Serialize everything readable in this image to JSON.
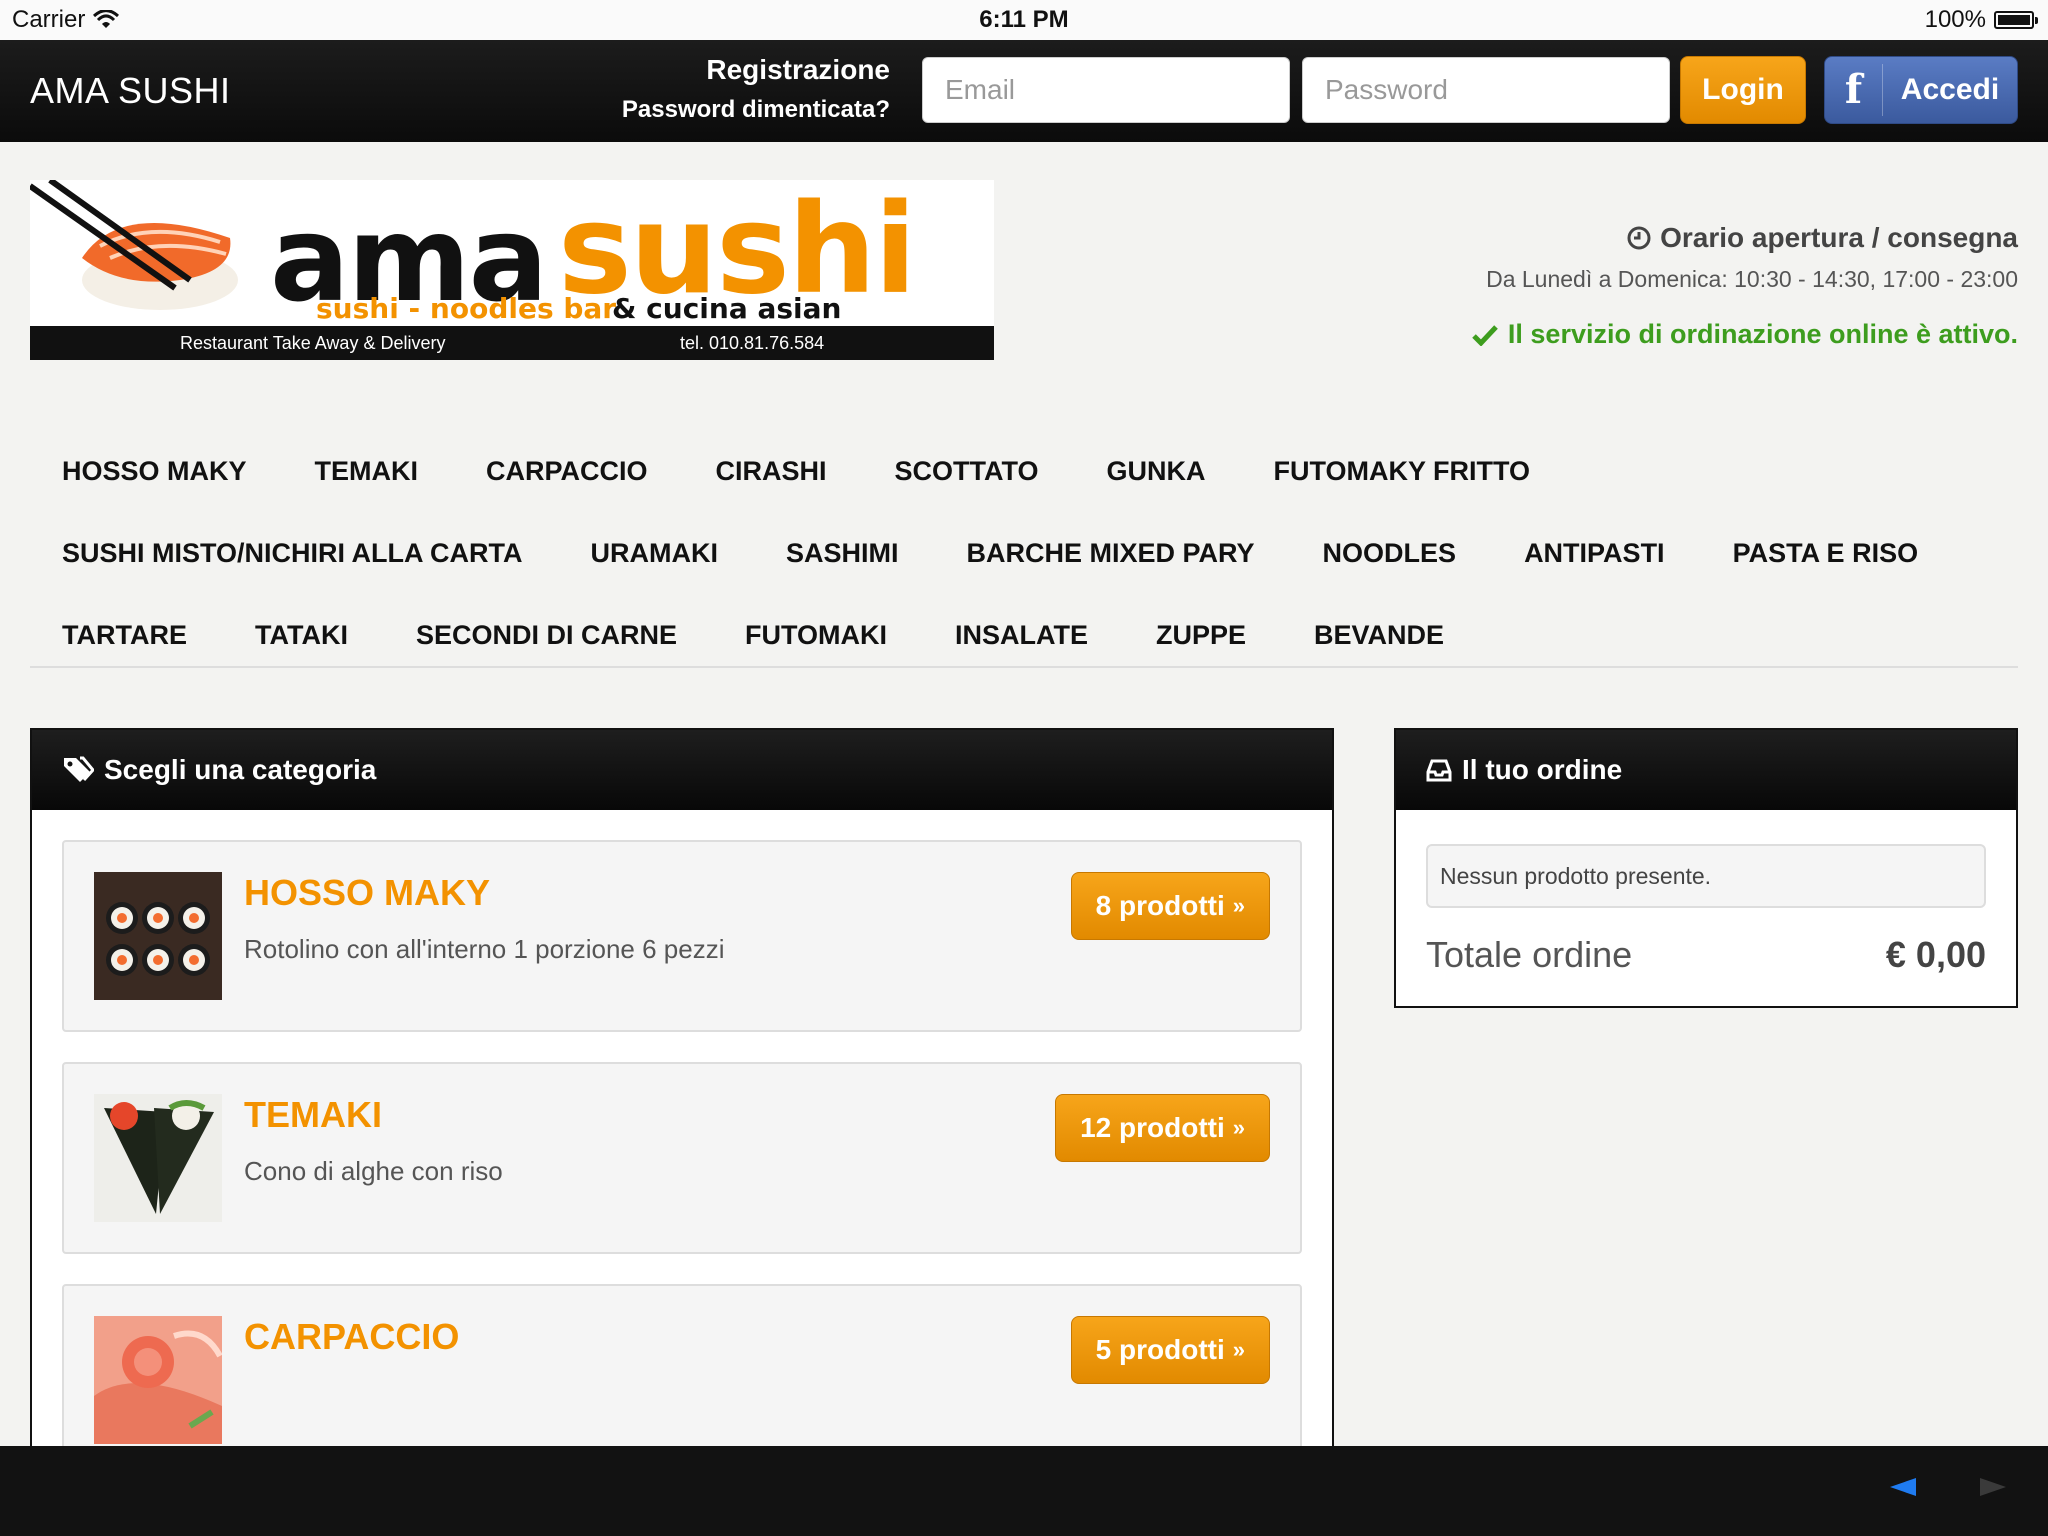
{
  "status_bar": {
    "carrier": "Carrier",
    "time": "6:11 PM",
    "battery": "100%"
  },
  "topnav": {
    "brand": "AMA SUSHI",
    "register": "Registrazione",
    "forgot_password": "Password dimenticata?",
    "email_placeholder": "Email",
    "password_placeholder": "Password",
    "login_label": "Login",
    "facebook_icon_glyph": "f",
    "facebook_label": "Accedi",
    "colors": {
      "login": "#f39200",
      "facebook": "#3b5a9e"
    }
  },
  "logo": {
    "word_1": "ama",
    "word_2": "sushi",
    "subtitle_1": "sushi - noodles bar",
    "subtitle_2": "& cucina asian",
    "tagline": "Restaurant Take Away & Delivery",
    "phone": "tel. 010.81.76.584"
  },
  "hours": {
    "title": "Orario apertura / consegna",
    "detail": "Da Lunedì a Domenica: 10:30 - 14:30, 17:00 - 23:00",
    "status": "Il servizio di ordinazione online è attivo.",
    "status_color": "#3d9d1e"
  },
  "category_menu": {
    "rows": [
      [
        "HOSSO MAKY",
        "TEMAKI",
        "CARPACCIO",
        "CIRASHI",
        "SCOTTATO",
        "GUNKA",
        "FUTOMAKY FRITTO"
      ],
      [
        "SUSHI MISTO/NICHIRI ALLA CARTA",
        "URAMAKI",
        "SASHIMI",
        "BARCHE MIXED PARY",
        "NOODLES",
        "ANTIPASTI",
        "PASTA E RISO"
      ],
      [
        "TARTARE",
        "TATAKI",
        "SECONDI DI CARNE",
        "FUTOMAKI",
        "INSALATE",
        "ZUPPE",
        "BEVANDE"
      ]
    ]
  },
  "category_panel": {
    "title": "Scegli una categoria",
    "items": [
      {
        "title": "HOSSO MAKY",
        "description": "Rotolino con all'interno 1 porzione 6 pezzi",
        "count": "8 prodotti",
        "arrow": "»"
      },
      {
        "title": "TEMAKI",
        "description": "Cono di alghe con riso",
        "count": "12 prodotti",
        "arrow": "»"
      },
      {
        "title": "CARPACCIO",
        "description": "",
        "count": "5 prodotti",
        "arrow": "»"
      }
    ]
  },
  "order_panel": {
    "title": "Il tuo ordine",
    "empty_message": "Nessun prodotto presente.",
    "total_label": "Totale ordine",
    "total_value": "€ 0,00"
  },
  "accent_color": "#f39200"
}
